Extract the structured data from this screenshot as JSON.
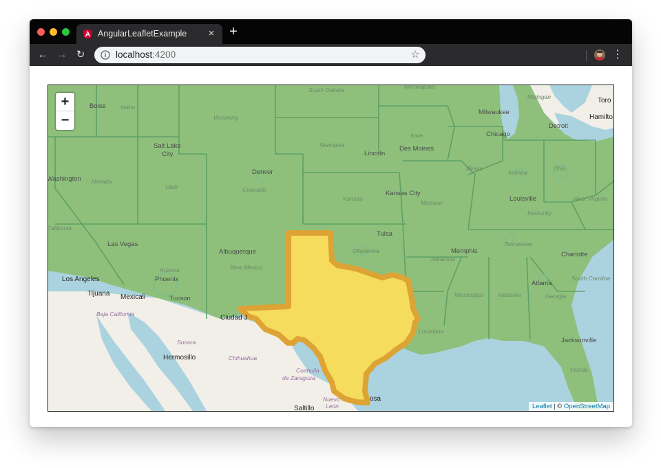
{
  "browser": {
    "tab_title": "AngularLeafletExample",
    "tab_close": "×",
    "new_tab": "+",
    "url_host": "localhost",
    "url_port": ":4200",
    "back": "←",
    "forward": "→",
    "reload": "↻",
    "star": "☆",
    "menu": "⋮"
  },
  "map": {
    "zoom_in": "+",
    "zoom_out": "−",
    "attribution_leaflet": "Leaflet",
    "attribution_sep": " | © ",
    "attribution_osm": "OpenStreetMap",
    "highlight_color": "#f5dc5c",
    "highlight_border": "#dda335",
    "land_color": "#8ec07c",
    "water_color": "#aad3df",
    "labels": {
      "boise": "Boise",
      "idaho": "Idaho",
      "wyoming": "Wyoming",
      "south_dakota": "South Dakota",
      "minneapolis": "Minneapolis",
      "milwaukee": "Milwaukee",
      "michigan": "Michigan",
      "toronto": "Toro",
      "hamilton": "Hamilto",
      "detroit": "Detroit",
      "chicago": "Chicago",
      "salt_lake_city_1": "Salt Lake",
      "salt_lake_city_2": "City",
      "nebraska": "Nebraska",
      "lincoln": "Lincoln",
      "iowa": "Iowa",
      "des_moines": "Des Moines",
      "nevada": "Nevada",
      "washington_carson": "Washington",
      "utah": "Utah",
      "denver": "Denver",
      "colorado": "Colorado",
      "kansas": "Kansas",
      "kansas_city": "Kansas City",
      "missouri": "Missouri",
      "illinois": "Illinois",
      "indiana": "Indiana",
      "ohio": "Ohio",
      "louisville": "Louisville",
      "west_virginia": "West Virginia",
      "kentucky": "Kentucky",
      "california": "California",
      "las_vegas": "Las Vegas",
      "albuquerque": "Albuquerque",
      "new_mexico": "New Mexico",
      "tulsa": "Tulsa",
      "oklahoma": "Oklahoma",
      "tennessee": "Tennessee",
      "memphis": "Memphis",
      "arkansas": "Arkansas",
      "charlotte": "Charlotte",
      "arizona": "Arizona",
      "phoenix": "Phoenix",
      "los_angeles": "Los Angeles",
      "tijuana": "Tijuana",
      "mexicali": "Mexicali",
      "tucson": "Tucson",
      "mississippi": "Mississippi",
      "alabama": "Alabama",
      "atlanta": "Atlanta",
      "georgia": "Georgia",
      "south_carolina": "South Carolina",
      "louisiana": "Louisiana",
      "ciudad_juarez": "Ciudad J",
      "baja_california": "Baja California",
      "sonora": "Sonora",
      "hermosillo": "Hermosillo",
      "chihuahua": "Chihuahua",
      "coahuila_1": "Coahuila",
      "coahuila_2": "de Zaragoza",
      "nuevo_leon_1": "Nuevo",
      "nuevo_leon_2": "León",
      "saltillo": "Saltillo",
      "reynosa": "osa",
      "jacksonville": "Jacksonville",
      "florida": "Florida"
    }
  }
}
